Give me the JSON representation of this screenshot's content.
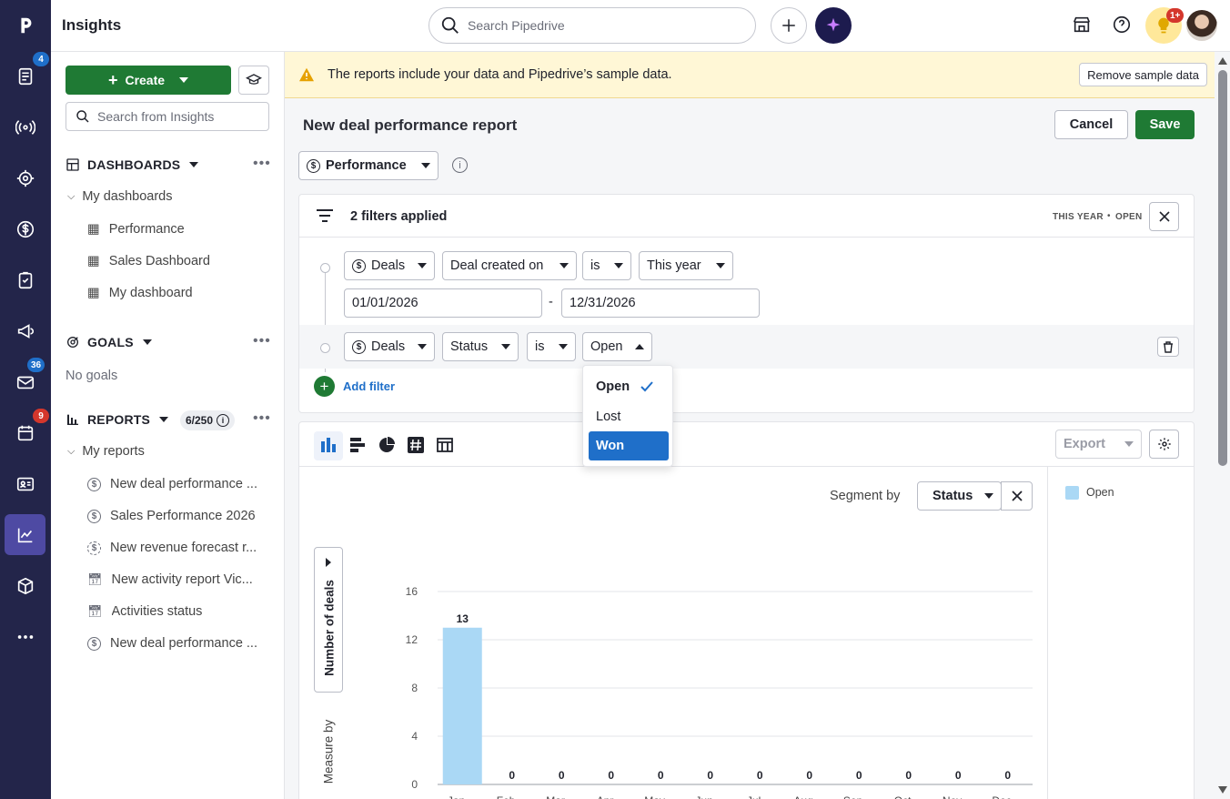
{
  "app": {
    "title": "Insights",
    "search_placeholder": "Search Pipedrive",
    "notification_badge": "1+"
  },
  "rail": {
    "badges": {
      "leads": "4",
      "mail": "36",
      "calendar": "9"
    }
  },
  "sidebar": {
    "create_label": "Create",
    "search_placeholder": "Search from Insights",
    "dashboards": {
      "heading": "DASHBOARDS",
      "group": "My dashboards",
      "items": [
        "Performance",
        "Sales Dashboard",
        "My dashboard"
      ]
    },
    "goals": {
      "heading": "GOALS",
      "empty": "No goals"
    },
    "reports": {
      "heading": "REPORTS",
      "count": "6/250",
      "group": "My reports",
      "items": [
        "New deal performance ...",
        "Sales Performance 2026",
        "New revenue forecast r...",
        "New activity report Vic...",
        "Activities status",
        "New deal performance ..."
      ]
    }
  },
  "banner": {
    "text": "The reports include your data and Pipedrive’s sample data.",
    "button": "Remove sample data"
  },
  "report": {
    "title": "New deal performance report",
    "cancel": "Cancel",
    "save": "Save",
    "type": "Performance",
    "filters_summary": "2 filters applied",
    "filter_tags": [
      "THIS YEAR",
      "OPEN"
    ],
    "filter1": {
      "entity": "Deals",
      "field": "Deal created on",
      "op": "is",
      "value": "This year",
      "from": "01/01/2026",
      "to": "12/31/2026",
      "sep": "-"
    },
    "filter2": {
      "entity": "Deals",
      "field": "Status",
      "op": "is",
      "value": "Open"
    },
    "add_filter": "Add filter",
    "status_options": [
      "Open",
      "Lost",
      "Won"
    ],
    "export": "Export",
    "segment_label": "Segment by",
    "segment_value": "Status",
    "measure_label": "Number of deals",
    "measure_by": "Measure by"
  },
  "colors": {
    "accent_green": "#1f7a34",
    "bar": "#aad8f5",
    "selected": "#1f6fc9",
    "rail": "#23254a"
  },
  "chart_data": {
    "type": "bar",
    "categories": [
      "Jan ...",
      "Feb ...",
      "Mar ...",
      "Apr ...",
      "May ...",
      "Jun ...",
      "Jul ...",
      "Aug ...",
      "Sep ...",
      "Oct ...",
      "Nov ...",
      "Dec ..."
    ],
    "series": [
      {
        "name": "Open",
        "values": [
          13,
          0,
          0,
          0,
          0,
          0,
          0,
          0,
          0,
          0,
          0,
          0
        ]
      }
    ],
    "ylim": [
      0,
      16
    ],
    "yticks": [
      0,
      4,
      8,
      12,
      16
    ],
    "ylabel": "Number of deals",
    "grid": true,
    "legend": "right"
  }
}
